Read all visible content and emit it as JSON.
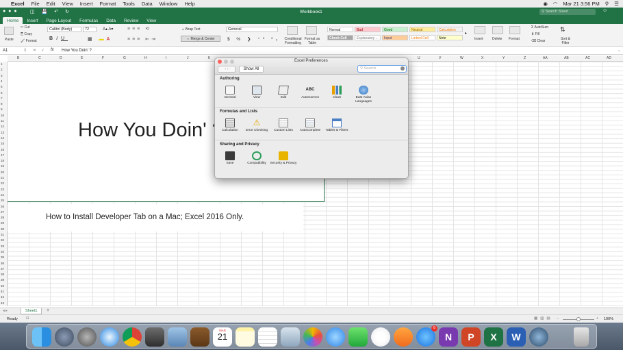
{
  "menubar": {
    "apple": "",
    "app": "Excel",
    "items": [
      "File",
      "Edit",
      "View",
      "Insert",
      "Format",
      "Tools",
      "Data",
      "Window",
      "Help"
    ],
    "clock": "Mar 21  3:56 PM"
  },
  "window": {
    "title": "Workbook1",
    "search_placeholder": "Search Sheet"
  },
  "ribbon_tabs": [
    "Home",
    "Insert",
    "Page Layout",
    "Formulas",
    "Data",
    "Review",
    "View"
  ],
  "ribbon": {
    "paste": "Paste",
    "cut": "Cut",
    "copy": "Copy",
    "format": "Format",
    "font_name": "Calibri (Body)",
    "font_size": "72",
    "wrap_text": "Wrap Text",
    "merge_center": "Merge & Center",
    "number_format": "General",
    "conditional_formatting": "Conditional Formatting",
    "format_as_table": "Format as Table",
    "styles": [
      "Normal",
      "Bad",
      "Good",
      "Neutral",
      "Calculation",
      "Check Cell",
      "Explanatory ...",
      "Input",
      "Linked Cell",
      "Note"
    ],
    "insert": "Insert",
    "delete": "Delete",
    "format_cells": "Format",
    "autosum": "AutoSum",
    "fill": "Fill",
    "clear": "Clear",
    "sort_filter": "Sort & Filter"
  },
  "formula_bar": {
    "cell_ref": "A1",
    "fx": "fx",
    "content": "How You Doin' ?"
  },
  "columns": [
    "B",
    "C",
    "D",
    "E",
    "F",
    "G",
    "H",
    "I",
    "J",
    "K",
    "",
    "",
    "",
    "",
    "",
    "",
    "U",
    "V",
    "W",
    "X",
    "Y",
    "Z",
    "AA",
    "AB",
    "AC",
    "AD"
  ],
  "rows": [
    "1",
    "2",
    "3",
    "4",
    "5",
    "6",
    "7",
    "8",
    "9",
    "10",
    "11",
    "12",
    "13",
    "14",
    "15",
    "16",
    "17",
    "18",
    "19",
    "20",
    "21",
    "22",
    "23",
    "24",
    "25",
    "26",
    "27",
    "28",
    "29",
    "30",
    "31",
    "32",
    "33",
    "34",
    "35",
    "36",
    "37",
    "38",
    "39",
    "40",
    "41",
    "42",
    "43"
  ],
  "sheet": {
    "big_text": "How You Doin' ?",
    "sub_text": "How to Install Developer Tab on a Mac; Excel 2016 Only."
  },
  "sheet_tabs": {
    "tab": "Sheet1",
    "add": "+"
  },
  "status": {
    "ready": "Ready",
    "zoom": "100%"
  },
  "prefs": {
    "title": "Excel Preferences",
    "show_all": "Show All",
    "search_placeholder": "Search",
    "sections": [
      {
        "title": "Authoring",
        "items": [
          "General",
          "View",
          "Edit",
          "AutoCorrect",
          "Chart",
          "East Asian Languages"
        ]
      },
      {
        "title": "Formulas and Lists",
        "items": [
          "Calculation",
          "Error Checking",
          "Custom Lists",
          "AutoComplete",
          "Tables & Filters"
        ]
      },
      {
        "title": "Sharing and Privacy",
        "items": [
          "Save",
          "Compatibility",
          "Security & Privacy"
        ]
      }
    ]
  },
  "dock": {
    "calendar_month": "MAR",
    "calendar_day": "21",
    "appstore_badge": "6",
    "icons": [
      "finder-icon",
      "launchpad-icon",
      "system-preferences-icon",
      "safari-icon",
      "chrome-icon",
      "calculator-icon",
      "preview-icon",
      "notebook-icon",
      "calendar-icon",
      "notes-icon",
      "reminders-icon",
      "photo-viewer-icon",
      "photos-icon",
      "messages-icon",
      "facetime-icon",
      "itunes-icon",
      "ibooks-icon",
      "app-store-icon",
      "onenote-icon",
      "powerpoint-icon",
      "excel-icon",
      "word-icon",
      "quicktime-icon",
      "trash-icon"
    ]
  },
  "colors": {
    "excel_green": "#217346",
    "selection": "#217346"
  }
}
